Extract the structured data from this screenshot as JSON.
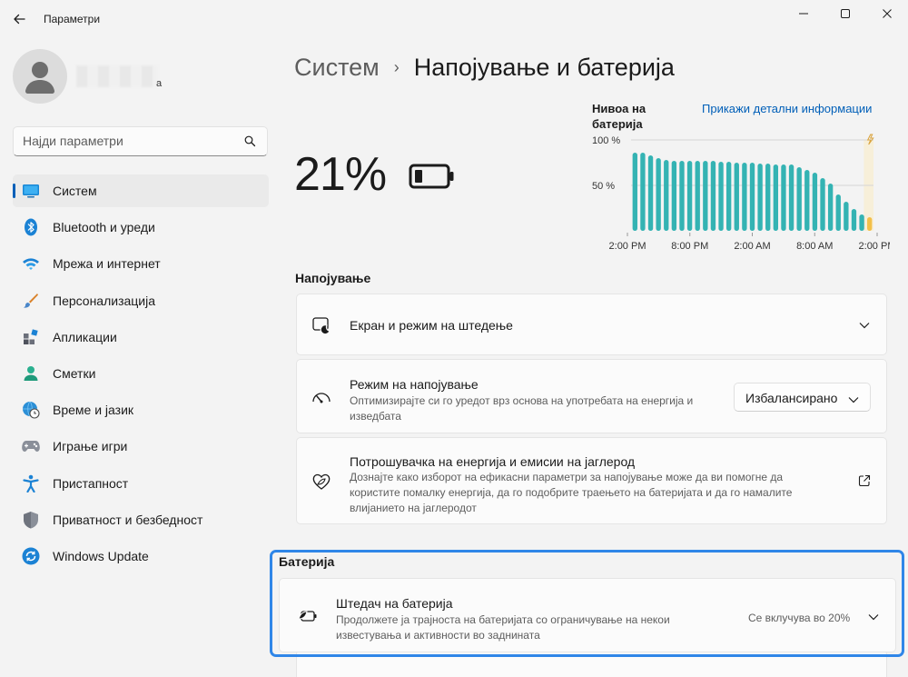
{
  "window": {
    "title": "Параметри"
  },
  "sidebar": {
    "user_name_tail": "а",
    "search": {
      "placeholder": "Најди параметри"
    },
    "items": [
      {
        "label": "Систем",
        "icon": "system-icon",
        "active": true
      },
      {
        "label": "Bluetooth и уреди",
        "icon": "bluetooth-icon"
      },
      {
        "label": "Мрежа и интернет",
        "icon": "wifi-icon"
      },
      {
        "label": "Персонализација",
        "icon": "brush-icon"
      },
      {
        "label": "Апликации",
        "icon": "apps-icon"
      },
      {
        "label": "Сметки",
        "icon": "account-icon"
      },
      {
        "label": "Време и јазик",
        "icon": "globe-clock-icon"
      },
      {
        "label": "Играње игри",
        "icon": "gamepad-icon"
      },
      {
        "label": "Пристапност",
        "icon": "accessibility-icon"
      },
      {
        "label": "Приватност и безбедност",
        "icon": "shield-icon"
      },
      {
        "label": "Windows Update",
        "icon": "update-icon"
      }
    ]
  },
  "header": {
    "breadcrumb_parent": "Систем",
    "breadcrumb_separator": "›",
    "breadcrumb_current": "Напојување и батерија"
  },
  "battery": {
    "percent_label": "21%",
    "level_fraction": 0.21,
    "level_title": "Нивоа на батерија",
    "details_link": "Прикажи детални информации"
  },
  "chart_data": {
    "type": "bar",
    "title": "Нивоа на батерија",
    "y_ticks": [
      "100 %",
      "50 %"
    ],
    "x_ticks": [
      "2:00 PM",
      "8:00 PM",
      "2:00 AM",
      "8:00 AM",
      "2:00 PM"
    ],
    "ylim": [
      0,
      100
    ],
    "values": [
      86,
      86,
      83,
      80,
      78,
      77,
      77,
      77,
      77,
      77,
      77,
      76,
      76,
      75,
      75,
      75,
      74,
      74,
      73,
      73,
      73,
      70,
      67,
      64,
      58,
      52,
      40,
      32,
      24,
      18,
      15
    ],
    "colors": {
      "normal": "#34b3b3",
      "current": "#f3c04a",
      "charging_band": "#f7efd9"
    }
  },
  "power": {
    "section_title": "Напојување",
    "screen_sleep": {
      "title": "Екран и режим на штедење"
    },
    "power_mode": {
      "title": "Режим на напојување",
      "description": "Оптимизирајте си го уредот врз основа на употребата на енергија и изведбата",
      "value": "Избалансирано"
    },
    "energy": {
      "title": "Потрошувачка на енергија и емисии на јаглерод",
      "description": "Дознајте како изборот на ефикасни параметри за напојување може да ви помогне да користите помалку енергија, да го подобрите траењето на батеријата и да го намалите влијанието на јаглеродот"
    }
  },
  "battery_section": {
    "title": "Батерија",
    "saver": {
      "title": "Штедач на батерија",
      "description": "Продолжете ја трајноста на батеријата со ограничување на некои известувања и активности во заднината",
      "status": "Се вклучува во 20%"
    }
  },
  "colors": {
    "accent": "#005fb8",
    "highlight_border": "#2f86e8",
    "chart_bar": "#34b3b3"
  }
}
